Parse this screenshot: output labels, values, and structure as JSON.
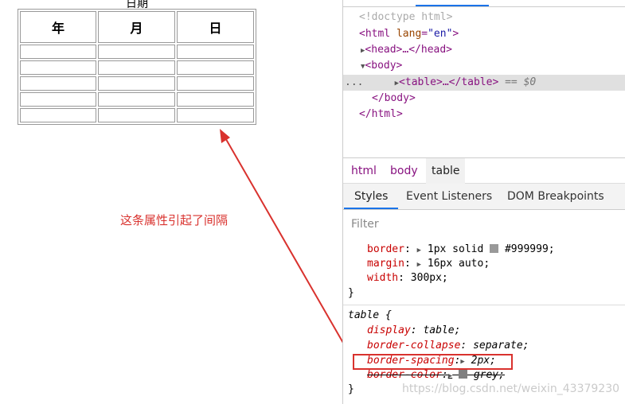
{
  "page": {
    "caption": "日期",
    "headers": [
      "年",
      "月",
      "日"
    ],
    "rows": 5
  },
  "devtools": {
    "elements": {
      "doctype": "<!doctype html>",
      "html_open_tag": "html",
      "html_attr": "lang",
      "html_attr_value": "\"en\"",
      "head": "<head>…</head>",
      "body_open": "<body>",
      "table": "<table>…</table>",
      "selected_marker": "== $0",
      "body_close": "</body>",
      "html_close": "</html>",
      "dots": "..."
    },
    "breadcrumbs": [
      "html",
      "body",
      "table"
    ],
    "tabs": [
      "Styles",
      "Event Listeners",
      "DOM Breakpoints"
    ],
    "filter_placeholder": "Filter",
    "rule1": {
      "border_prop": "border",
      "border_val": "1px solid",
      "border_color": "#999999",
      "margin_prop": "margin",
      "margin_val": "16px auto;",
      "width_prop": "width",
      "width_val": "300px;",
      "close": "}"
    },
    "rule2": {
      "selector": "table {",
      "display_prop": "display",
      "display_val": "table;",
      "collapse_prop": "border-collapse",
      "collapse_val": "separate;",
      "spacing_prop": "border-spacing",
      "spacing_val": "2px;",
      "color_prop": "border-color",
      "color_val": "grey;",
      "close": "}"
    }
  },
  "annotation": {
    "note": "这条属性引起了间隔",
    "color": "#d9322e"
  },
  "watermark": "https://blog.csdn.net/weixin_43379230"
}
